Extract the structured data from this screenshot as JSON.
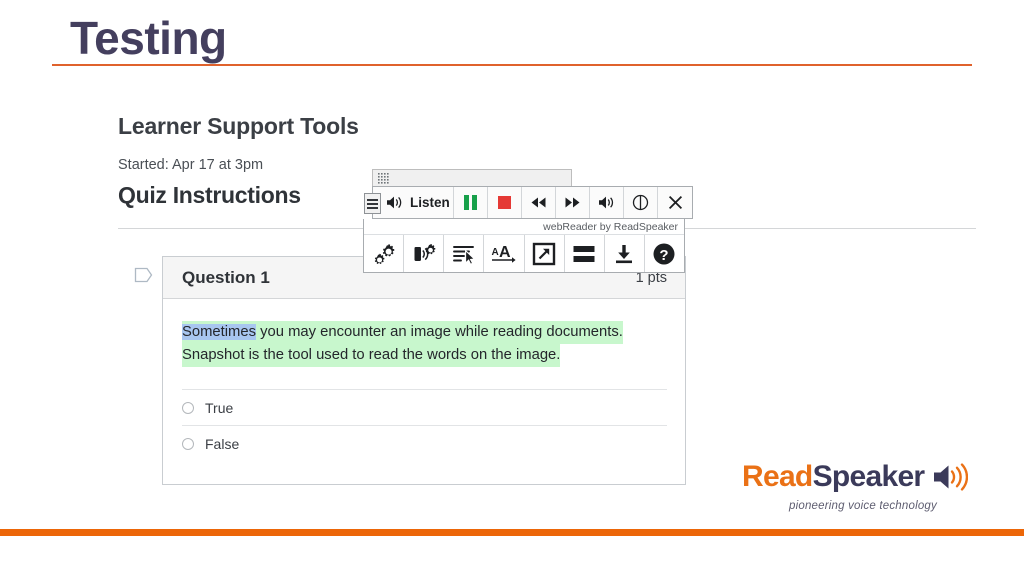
{
  "slide": {
    "title": "Testing",
    "rule_color": "#e0622c"
  },
  "quiz": {
    "heading": "Learner Support Tools",
    "started": "Started: Apr 17 at 3pm",
    "instructions_heading": "Quiz Instructions",
    "question": {
      "title": "Question 1",
      "points": "1 pts",
      "flag_icon": "tag-flag-icon",
      "text_line1_highlighted_word": "Sometimes",
      "text_line1_rest": " you may encounter an image while reading documents.",
      "text_line2": "Snapshot is the tool used to read the words on the image.",
      "sentence_highlight_color": "#c8f7cd",
      "word_highlight_color": "#a8c6f0",
      "options": [
        {
          "label": "True",
          "selected": false
        },
        {
          "label": "False",
          "selected": false
        }
      ]
    }
  },
  "readspeaker_toolbar": {
    "drag_handle_icon": "drag-grid-icon",
    "menu_icon": "hamburger-menu-icon",
    "listen_label": "Listen",
    "listen_icon": "speaker-icon",
    "controls": [
      {
        "name": "pause-button",
        "icon": "pause-icon",
        "color": "#17a04a"
      },
      {
        "name": "stop-button",
        "icon": "stop-square-icon",
        "color": "#e53935"
      },
      {
        "name": "rewind-button",
        "icon": "rewind-icon"
      },
      {
        "name": "forward-button",
        "icon": "fast-forward-icon"
      },
      {
        "name": "volume-button",
        "icon": "volume-icon"
      },
      {
        "name": "speed-button",
        "icon": "speed-dial-icon"
      },
      {
        "name": "close-button",
        "icon": "close-x-icon"
      }
    ],
    "brand_label": "webReader by ReadSpeaker",
    "tools": [
      {
        "name": "settings-button",
        "icon": "gears-settings-icon"
      },
      {
        "name": "voice-settings-button",
        "icon": "voice-settings-icon"
      },
      {
        "name": "reading-mode-button",
        "icon": "text-cursor-icon"
      },
      {
        "name": "text-size-button",
        "icon": "font-size-icon"
      },
      {
        "name": "enlarge-button",
        "icon": "expand-arrow-icon"
      },
      {
        "name": "page-mask-button",
        "icon": "page-mask-icon"
      },
      {
        "name": "download-button",
        "icon": "download-icon"
      },
      {
        "name": "help-button",
        "icon": "help-question-icon"
      }
    ]
  },
  "logo": {
    "word_read": "Read",
    "word_speaker": "Speaker",
    "tagline": "pioneering voice technology",
    "read_color": "#ea7116",
    "speaker_color": "#3b3a5a",
    "speaker_icon": "speaker-wave-icon"
  },
  "bottom_bar": {
    "color": "#ec6608"
  }
}
